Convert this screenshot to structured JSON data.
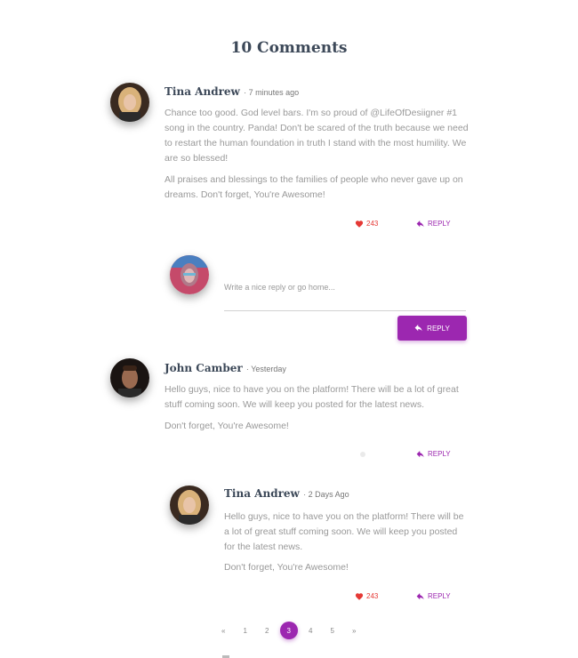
{
  "heading": "10 Comments",
  "comments": [
    {
      "author": "Tina Andrew",
      "time": "· 7 minutes ago",
      "paragraphs": [
        "Chance too good. God level bars. I'm so proud of @LifeOfDesiigner #1 song in the country. Panda! Don't be scared of the truth because we need to restart the human foundation in truth I stand with the most humility. We are so blessed!",
        "All praises and blessings to the families of people who never gave up on dreams. Don't forget, You're Awesome!"
      ],
      "likes": "243",
      "reply_label": "REPLY"
    },
    {
      "author": "John Camber",
      "time": "· Yesterday",
      "paragraphs": [
        "Hello guys, nice to have you on the platform! There will be a lot of great stuff coming soon. We will keep you posted for the latest news.",
        "Don't forget, You're Awesome!"
      ],
      "reply_label": "REPLY"
    },
    {
      "author": "Tina Andrew",
      "time": "· 2 Days Ago",
      "paragraphs": [
        "Hello guys, nice to have you on the platform! There will be a lot of great stuff coming soon. We will keep you posted for the latest news.",
        "Don't forget, You're Awesome!"
      ],
      "likes": "243",
      "reply_label": "REPLY"
    }
  ],
  "reply_form": {
    "placeholder": "Write a nice reply or go home...",
    "button_label": "REPLY"
  },
  "pagination": {
    "prev": "«",
    "pages": [
      "1",
      "2",
      "3",
      "4",
      "5"
    ],
    "active": "3",
    "next": "»"
  },
  "colors": {
    "accent": "#9c27b0",
    "heart": "#e53935",
    "heading": "#3c4858",
    "text": "#999999"
  },
  "icons": {
    "like": "heart-icon",
    "reply": "reply-arrow-icon"
  }
}
